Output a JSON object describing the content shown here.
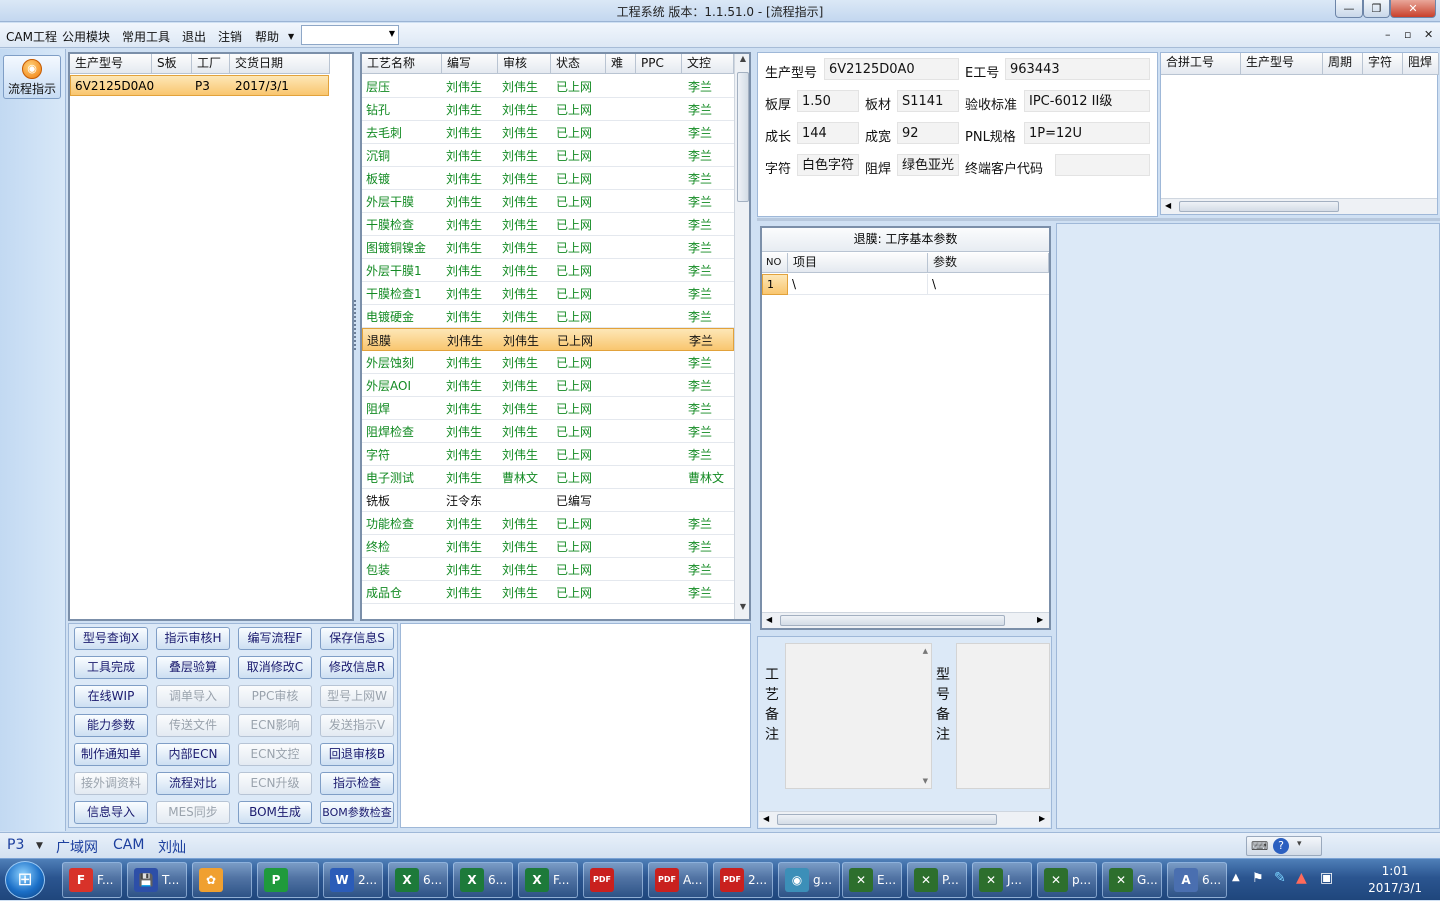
{
  "window": {
    "title": "工程系统   版本：1.1.51.0 - [流程指示]",
    "minimize": "—",
    "restore": "❐",
    "close": "✕"
  },
  "menu": {
    "items": [
      "CAM工程",
      "公用模块",
      "常用工具",
      "退出",
      "注销",
      "帮助"
    ],
    "dropdown_value": "",
    "mdi_min": "–",
    "mdi_restore": "▫",
    "mdi_close": "✕"
  },
  "nav": {
    "button_label": "流程指示"
  },
  "order_grid": {
    "columns": [
      "生产型号",
      "S板",
      "工厂",
      "交货日期"
    ],
    "rows": [
      [
        "6V2125D0A0",
        "",
        "P3",
        "2017/3/1"
      ]
    ]
  },
  "process_grid": {
    "columns": [
      "工艺名称",
      "编写",
      "审核",
      "状态",
      "难",
      "PPC",
      "文控"
    ],
    "selected_index": 11,
    "rows": [
      [
        "层压",
        "刘伟生",
        "刘伟生",
        "已上网",
        "",
        "",
        "李兰"
      ],
      [
        "钻孔",
        "刘伟生",
        "刘伟生",
        "已上网",
        "",
        "",
        "李兰"
      ],
      [
        "去毛刺",
        "刘伟生",
        "刘伟生",
        "已上网",
        "",
        "",
        "李兰"
      ],
      [
        "沉铜",
        "刘伟生",
        "刘伟生",
        "已上网",
        "",
        "",
        "李兰"
      ],
      [
        "板镀",
        "刘伟生",
        "刘伟生",
        "已上网",
        "",
        "",
        "李兰"
      ],
      [
        "外层干膜",
        "刘伟生",
        "刘伟生",
        "已上网",
        "",
        "",
        "李兰"
      ],
      [
        "干膜检查",
        "刘伟生",
        "刘伟生",
        "已上网",
        "",
        "",
        "李兰"
      ],
      [
        "图镀铜镍金",
        "刘伟生",
        "刘伟生",
        "已上网",
        "",
        "",
        "李兰"
      ],
      [
        "外层干膜1",
        "刘伟生",
        "刘伟生",
        "已上网",
        "",
        "",
        "李兰"
      ],
      [
        "干膜检查1",
        "刘伟生",
        "刘伟生",
        "已上网",
        "",
        "",
        "李兰"
      ],
      [
        "电镀硬金",
        "刘伟生",
        "刘伟生",
        "已上网",
        "",
        "",
        "李兰"
      ],
      [
        "退膜",
        "刘伟生",
        "刘伟生",
        "已上网",
        "",
        "",
        "李兰"
      ],
      [
        "外层蚀刻",
        "刘伟生",
        "刘伟生",
        "已上网",
        "",
        "",
        "李兰"
      ],
      [
        "外层AOI",
        "刘伟生",
        "刘伟生",
        "已上网",
        "",
        "",
        "李兰"
      ],
      [
        "阻焊",
        "刘伟生",
        "刘伟生",
        "已上网",
        "",
        "",
        "李兰"
      ],
      [
        "阻焊检查",
        "刘伟生",
        "刘伟生",
        "已上网",
        "",
        "",
        "李兰"
      ],
      [
        "字符",
        "刘伟生",
        "刘伟生",
        "已上网",
        "",
        "",
        "李兰"
      ],
      [
        "电子测试",
        "刘伟生",
        "曹林文",
        "已上网",
        "",
        "",
        "曹林文"
      ],
      [
        "铣板",
        "汪令东",
        "",
        "已编写",
        "",
        "",
        ""
      ],
      [
        "功能检查",
        "刘伟生",
        "刘伟生",
        "已上网",
        "",
        "",
        "李兰"
      ],
      [
        "终检",
        "刘伟生",
        "刘伟生",
        "已上网",
        "",
        "",
        "李兰"
      ],
      [
        "包装",
        "刘伟生",
        "刘伟生",
        "已上网",
        "",
        "",
        "李兰"
      ],
      [
        "成品仓",
        "刘伟生",
        "刘伟生",
        "已上网",
        "",
        "",
        "李兰"
      ]
    ]
  },
  "buttons": [
    {
      "label": "型号查询X",
      "enabled": true
    },
    {
      "label": "指示审核H",
      "enabled": true
    },
    {
      "label": "编写流程F",
      "enabled": true
    },
    {
      "label": "保存信息S",
      "enabled": true
    },
    {
      "label": "工具完成",
      "enabled": true
    },
    {
      "label": "叠层验算",
      "enabled": true
    },
    {
      "label": "取消修改C",
      "enabled": true
    },
    {
      "label": "修改信息R",
      "enabled": true
    },
    {
      "label": "在线WIP",
      "enabled": true
    },
    {
      "label": "调单导入",
      "enabled": false
    },
    {
      "label": "PPC审核",
      "enabled": false
    },
    {
      "label": "型号上网W",
      "enabled": false
    },
    {
      "label": "能力参数",
      "enabled": true
    },
    {
      "label": "传送文件",
      "enabled": false
    },
    {
      "label": "ECN影响",
      "enabled": false
    },
    {
      "label": "发送指示V",
      "enabled": false
    },
    {
      "label": "制作通知单",
      "enabled": true
    },
    {
      "label": "内部ECN",
      "enabled": true
    },
    {
      "label": "ECN文控",
      "enabled": false
    },
    {
      "label": "回退审核B",
      "enabled": true
    },
    {
      "label": "接外调资料",
      "enabled": false
    },
    {
      "label": "流程对比",
      "enabled": true
    },
    {
      "label": "ECN升级",
      "enabled": false
    },
    {
      "label": "指示检查",
      "enabled": true
    },
    {
      "label": "信息导入",
      "enabled": true
    },
    {
      "label": "MES同步",
      "enabled": false
    },
    {
      "label": "BOM生成",
      "enabled": true
    },
    {
      "label": "BOM参数检查",
      "enabled": true
    }
  ],
  "info": {
    "model_label": "生产型号",
    "model_value": "6V2125D0A0",
    "eno_label": "E工号",
    "eno_value": "963443",
    "thickness_label": "板厚",
    "thickness_value": "1.50",
    "material_label": "板材",
    "material_value": "S1141",
    "standard_label": "验收标准",
    "standard_value": "IPC-6012 II级",
    "length_label": "成长",
    "length_value": "144",
    "width_label": "成宽",
    "width_value": "92",
    "pnl_label": "PNL规格",
    "pnl_value": "1P=12U",
    "char_label": "字符",
    "char_value": "白色字符",
    "mask_label": "阻焊",
    "mask_value": "绿色亚光",
    "customer_label": "终端客户代码",
    "customer_value": ""
  },
  "merge_grid": {
    "columns": [
      "合拼工号",
      "生产型号",
      "周期",
      "字符",
      "阻焊"
    ]
  },
  "param_panel": {
    "title": "退膜: 工序基本参数",
    "columns": [
      "NO",
      "项目",
      "参数"
    ],
    "rows": [
      [
        "1",
        "\\",
        "\\"
      ]
    ]
  },
  "remarks": {
    "process_label": "工艺备注",
    "model_label": "型号备注"
  },
  "statusbar": {
    "plant": "P3",
    "items": [
      "广域网",
      "CAM",
      "刘灿"
    ]
  },
  "taskbar": {
    "items": [
      {
        "label": "F...",
        "icon": "F",
        "color": "#d8322a"
      },
      {
        "label": "T...",
        "icon": "💾",
        "color": "#2d4fa8"
      },
      {
        "label": "",
        "icon": "✿",
        "color": "#f0a030"
      },
      {
        "label": "",
        "icon": "P",
        "color": "#1f9a3c"
      },
      {
        "label": "2...",
        "icon": "W",
        "color": "#2b5cb8"
      },
      {
        "label": "6...",
        "icon": "X",
        "color": "#1d7a3a"
      },
      {
        "label": "6...",
        "icon": "X",
        "color": "#1d7a3a"
      },
      {
        "label": "F...",
        "icon": "X",
        "color": "#1d7a3a"
      },
      {
        "label": "",
        "icon": "PDF",
        "color": "#c9201e"
      },
      {
        "label": "A...",
        "icon": "PDF",
        "color": "#c9201e"
      },
      {
        "label": "2...",
        "icon": "PDF",
        "color": "#c9201e"
      },
      {
        "label": "g...",
        "icon": "◉",
        "color": "#3c8fb8"
      },
      {
        "label": "E...",
        "icon": "✕",
        "color": "#2d6f2d"
      },
      {
        "label": "P...",
        "icon": "✕",
        "color": "#2d6f2d"
      },
      {
        "label": "J...",
        "icon": "✕",
        "color": "#2d6f2d"
      },
      {
        "label": "p...",
        "icon": "✕",
        "color": "#2d6f2d"
      },
      {
        "label": "G...",
        "icon": "✕",
        "color": "#2d6f2d"
      },
      {
        "label": "6...",
        "icon": "A",
        "color": "#4a6fb0"
      }
    ],
    "time": "1:01",
    "date": "2017/3/1"
  }
}
